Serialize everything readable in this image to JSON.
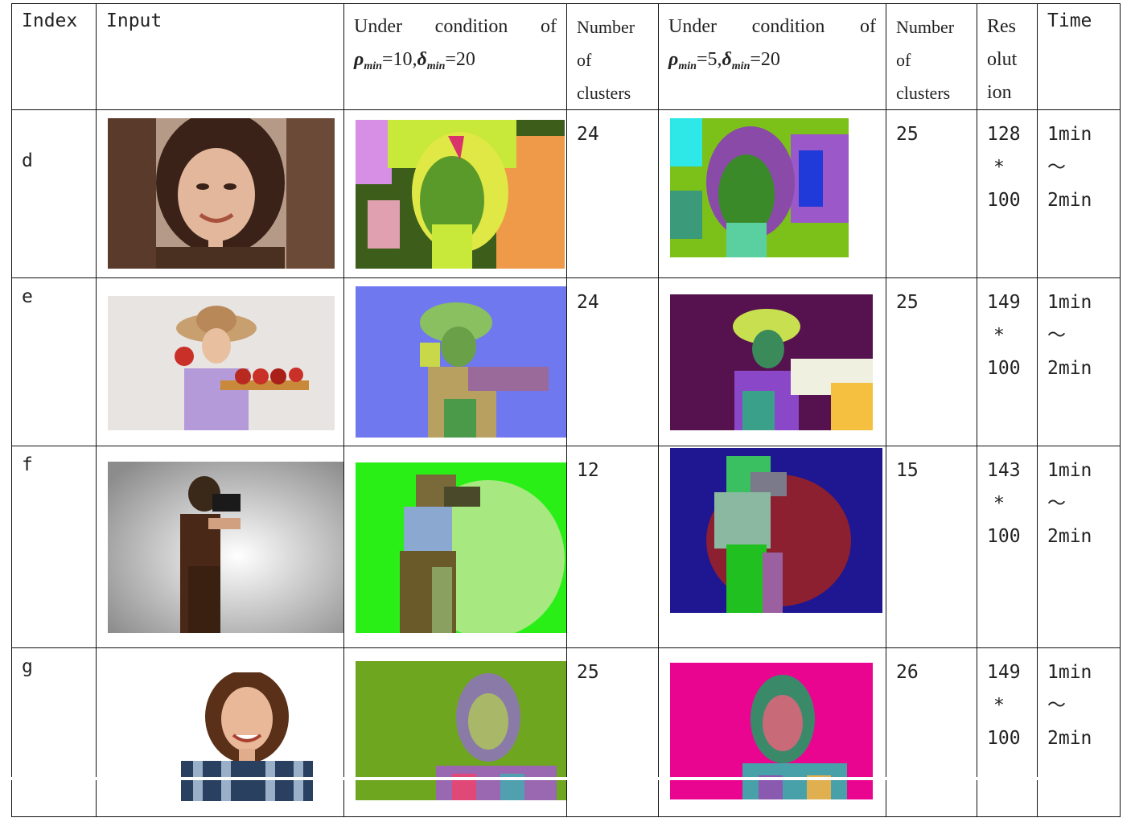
{
  "headers": {
    "index": "Index",
    "input": "Input",
    "cond1_text": "Under condition of",
    "cond1_rho_val": "=10,",
    "cond1_delta_val": "=20",
    "clusters1": [
      "Number",
      "of",
      "clusters"
    ],
    "cond2_text": "Under condition of",
    "cond2_rho_val": "=5,",
    "cond2_delta_val": "=20",
    "clusters2": [
      "Number",
      "of",
      "clusters"
    ],
    "resolution": [
      "Res",
      "olut",
      "ion"
    ],
    "time": "Time",
    "rho_symbol": "ρ",
    "delta_symbol": "δ",
    "min_sub": "min"
  },
  "rows": [
    {
      "index": "d",
      "clusters1": "24",
      "clusters2": "25",
      "res": [
        "128",
        "*",
        "100"
      ],
      "time": [
        "1min",
        "～",
        "2min"
      ],
      "img_input": "portrait-woman-sepia",
      "img_seg1": "segmentation-d-1",
      "img_seg2": "segmentation-d-2"
    },
    {
      "index": "e",
      "clusters1": "24",
      "clusters2": "25",
      "res": [
        "149",
        "*",
        "100"
      ],
      "time": [
        "1min",
        "～",
        "2min"
      ],
      "img_input": "girl-with-hat-and-apples",
      "img_seg1": "segmentation-e-1",
      "img_seg2": "segmentation-e-2"
    },
    {
      "index": "f",
      "clusters1": "12",
      "clusters2": "15",
      "res": [
        "143",
        "*",
        "100"
      ],
      "time": [
        "1min",
        "～",
        "2min"
      ],
      "img_input": "man-with-camera",
      "img_seg1": "segmentation-f-1",
      "img_seg2": "segmentation-f-2"
    },
    {
      "index": "g",
      "clusters1": "25",
      "clusters2": "26",
      "res": [
        "149",
        "*",
        "100"
      ],
      "time": [
        "1min",
        "～",
        "2min"
      ],
      "img_input": "smiling-woman-plaid",
      "img_seg1": "segmentation-g-1",
      "img_seg2": "segmentation-g-2"
    }
  ],
  "colors": {
    "d_seg1_bg": "#3d5e1b",
    "d_seg2_bg": "#7cc01a",
    "e_seg1_bg": "#6f78ee",
    "e_seg2_bg": "#56124f",
    "f_seg1_bg": "#2aef17",
    "f_seg2_bg": "#1f1691",
    "g_seg1_bg": "#6fa61f",
    "g_seg2_bg": "#ea0591"
  }
}
